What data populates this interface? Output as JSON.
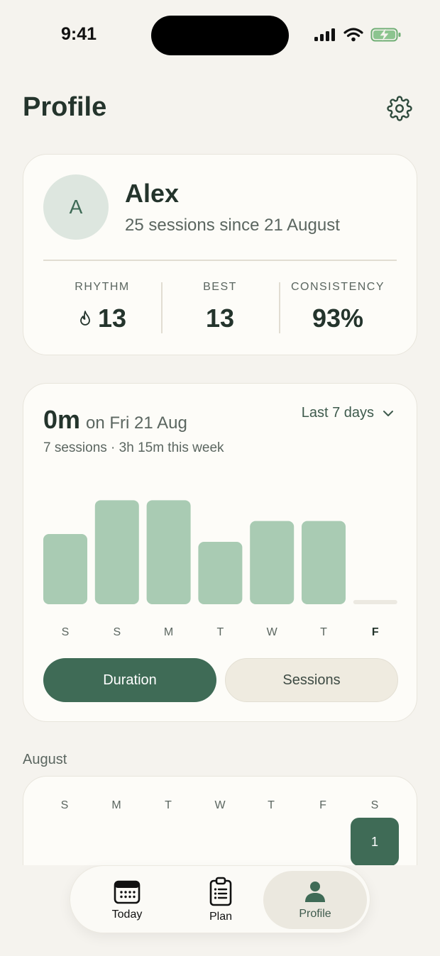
{
  "status_bar": {
    "time": "9:41"
  },
  "header": {
    "title": "Profile"
  },
  "profile": {
    "avatar_initial": "A",
    "name": "Alex",
    "subtitle": "25 sessions since 21 August",
    "stats": [
      {
        "label": "RHYTHM",
        "value": "13",
        "icon": "flame-icon"
      },
      {
        "label": "BEST",
        "value": "13"
      },
      {
        "label": "CONSISTENCY",
        "value": "93%"
      }
    ]
  },
  "activity": {
    "headline_value": "0m",
    "headline_date": "on Fri 21 Aug",
    "summary": "7 sessions · 3h 15m this week",
    "range_label": "Last 7 days",
    "toggle": {
      "active": "Duration",
      "inactive": "Sessions"
    }
  },
  "chart_data": {
    "type": "bar",
    "categories": [
      "S",
      "S",
      "M",
      "T",
      "W",
      "T",
      "F"
    ],
    "values": [
      27,
      40,
      40,
      24,
      32,
      32,
      0
    ],
    "ylim": [
      0,
      45
    ],
    "colors": {
      "bar": "#a9cbb3",
      "empty": "#ece9e1"
    }
  },
  "calendar": {
    "month": "August",
    "weekdays": [
      "S",
      "M",
      "T",
      "W",
      "T",
      "F",
      "S"
    ],
    "visible_days": [
      "1"
    ]
  },
  "tabbar": {
    "items": [
      {
        "label": "Today",
        "icon": "calendar-icon"
      },
      {
        "label": "Plan",
        "icon": "clipboard-icon"
      },
      {
        "label": "Profile",
        "icon": "person-icon",
        "active": true
      }
    ]
  },
  "colors": {
    "accent": "#3f6b56",
    "background": "#f5f3ee",
    "card": "#fdfcf8"
  }
}
